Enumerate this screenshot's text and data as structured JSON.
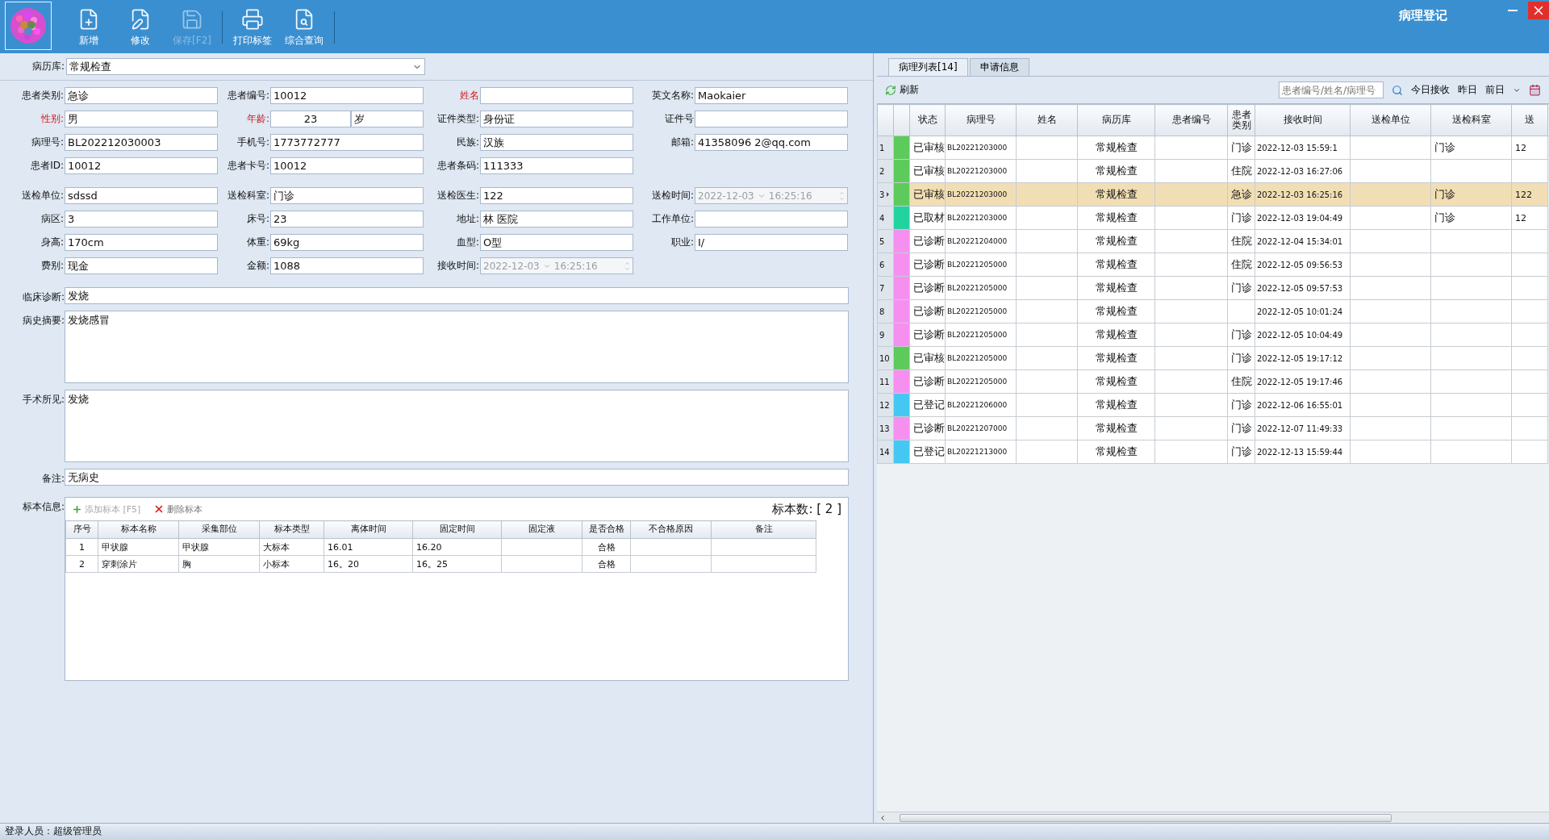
{
  "window": {
    "title": "病理登记"
  },
  "toolbar": [
    {
      "label": "新增",
      "kind": "new",
      "disabled": false
    },
    {
      "label": "修改",
      "kind": "edit",
      "disabled": false
    },
    {
      "label": "保存[F2]",
      "kind": "save",
      "disabled": true
    },
    {
      "label": "打印标签",
      "kind": "print",
      "disabled": false
    },
    {
      "label": "综合查询",
      "kind": "query",
      "disabled": false
    }
  ],
  "library": {
    "label": "病历库:",
    "value": "常规检查"
  },
  "groups": [
    {
      "rows": [
        [
          {
            "kind": "text",
            "label": "患者类别:",
            "value": "急诊",
            "required": false
          },
          {
            "kind": "text",
            "label": "患者编号:",
            "value": "10012",
            "required": false
          },
          {
            "kind": "text",
            "label": "姓名",
            "required": true
          },
          {
            "kind": "text",
            "label": "英文名称:",
            "value": "Maokaier",
            "required": false
          }
        ],
        [
          {
            "kind": "text",
            "label": "性别:",
            "value": "男",
            "required": true
          },
          {
            "kind": "age",
            "label": "年龄:",
            "value": "23",
            "unit": "岁",
            "required": true
          },
          {
            "kind": "text",
            "label": "证件类型:",
            "value": "身份证",
            "required": false
          },
          {
            "kind": "text",
            "label": "证件号",
            "required": false
          }
        ],
        [
          {
            "kind": "text",
            "label": "病理号:",
            "value": "BL202212030003",
            "required": false
          },
          {
            "kind": "text",
            "label": "手机号:",
            "value": "1773772777",
            "required": false
          },
          {
            "kind": "text",
            "label": "民族:",
            "value": "汉族",
            "required": false
          },
          {
            "kind": "text",
            "label": "邮箱:",
            "value": "41358096 2@qq.com",
            "required": false
          }
        ],
        [
          {
            "kind": "text",
            "label": "患者ID:",
            "value": "10012",
            "required": false
          },
          {
            "kind": "text",
            "label": "患者卡号:",
            "value": "10012",
            "required": false
          },
          {
            "kind": "text",
            "label": "患者条码:",
            "value": "111333",
            "required": false
          }
        ]
      ]
    },
    {
      "rows": [
        [
          {
            "kind": "text",
            "label": "送检单位:",
            "value": "sdssd",
            "required": false
          },
          {
            "kind": "text",
            "label": "送检科室:",
            "value": "门诊",
            "required": false
          },
          {
            "kind": "text",
            "label": "送检医生:",
            "value": "122",
            "required": false
          },
          {
            "kind": "datetime",
            "label": "送检时间:",
            "date": "2022-12-03",
            "time": "16:25:16",
            "required": false
          }
        ],
        [
          {
            "kind": "text",
            "label": "病区:",
            "value": "3",
            "required": false
          },
          {
            "kind": "text",
            "label": "床号:",
            "value": "23",
            "required": false
          },
          {
            "kind": "text",
            "label": "地址:",
            "value": "林        医院",
            "required": false
          },
          {
            "kind": "text",
            "label": "工作单位:",
            "required": false
          }
        ],
        [
          {
            "kind": "text",
            "label": "身高:",
            "value": "170cm",
            "required": false
          },
          {
            "kind": "text",
            "label": "体重:",
            "value": "69kg",
            "required": false
          },
          {
            "kind": "text",
            "label": "血型:",
            "value": "O型",
            "required": false
          },
          {
            "kind": "text",
            "label": "职业:",
            "value": "I/",
            "required": false
          }
        ],
        [
          {
            "kind": "text",
            "label": "费别:",
            "value": "现金",
            "required": false
          },
          {
            "kind": "text",
            "label": "金额:",
            "value": "1088",
            "required": false
          },
          {
            "kind": "datetime",
            "label": "接收时间:",
            "date": "2022-12-03",
            "time": "16:25:16",
            "required": false
          }
        ]
      ]
    }
  ],
  "wide_fields": [
    {
      "kind": "line",
      "label": "临床诊断:",
      "value": "发烧"
    },
    {
      "kind": "area",
      "label": "病史摘要:",
      "value": "发烧感冒"
    },
    {
      "kind": "area",
      "label": "手术所见:",
      "value": "发烧"
    },
    {
      "kind": "line",
      "label": "备注:",
      "value": "无病史"
    }
  ],
  "specimens": {
    "label": "标本信息:",
    "add": {
      "label": "添加标本 [F5]",
      "disabled": true
    },
    "remove": {
      "label": "删除标本",
      "disabled": false
    },
    "count_label": "标本数: [ 2 ]",
    "columns": [
      "序号",
      "标本名称",
      "采集部位",
      "标本类型",
      "离体时间",
      "固定时间",
      "固定液",
      "是否合格",
      "不合格原因",
      "备注"
    ],
    "rows": [
      [
        "1",
        "甲状腺",
        "甲状腺",
        "大标本",
        "16.01",
        "16.20",
        "",
        "合格",
        "",
        ""
      ],
      [
        "2",
        "穿刺涂片",
        "胸",
        "小标本",
        "16。20",
        "16。25",
        "",
        "合格",
        "",
        ""
      ]
    ]
  },
  "tabs": [
    {
      "label": "病理列表[14]",
      "selected": true
    },
    {
      "label": "申请信息",
      "selected": false
    }
  ],
  "list_toolbar": {
    "refresh": "刷新",
    "search_placeholder": "患者编号/姓名/病理号",
    "filters": [
      "今日接收",
      "昨日",
      "前日"
    ]
  },
  "table": {
    "columns": [
      "状态",
      "病理号",
      "姓名",
      "病历库",
      "患者编号",
      "患者类别",
      "接收时间",
      "送检单位",
      "送检科室",
      "送"
    ],
    "rows": [
      {
        "num": "1",
        "status": "已审核",
        "color": "#5ccb5c",
        "selected": false,
        "pathology_no": "BL20221203000",
        "library": "常规检查",
        "patient_type": "门诊",
        "received": "2022-12-03 15:59:1",
        "dept": "门诊",
        "column_10": "12"
      },
      {
        "num": "2",
        "status": "已审核",
        "color": "#5ccb5c",
        "selected": false,
        "pathology_no": "BL20221203000",
        "library": "常规检查",
        "patient_type": "住院",
        "received": "2022-12-03 16:27:06"
      },
      {
        "num": "3",
        "status": "已审核",
        "color": "#5ccb5c",
        "selected": true,
        "pathology_no": "BL20221203000",
        "library": "常规检查",
        "patient_type": "急诊",
        "received": "2022-12-03 16:25:16",
        "dept": "门诊",
        "column_10": "122"
      },
      {
        "num": "4",
        "status": "已取材",
        "color": "#22d3a0",
        "selected": false,
        "pathology_no": "BL20221203000",
        "library": "常规检查",
        "patient_type": "门诊",
        "received": "2022-12-03 19:04:49",
        "dept": "门诊",
        "column_10": "12"
      },
      {
        "num": "5",
        "status": "已诊断",
        "color": "#f590f0",
        "selected": false,
        "pathology_no": "BL20221204000",
        "library": "常规检查",
        "patient_type": "住院",
        "received": "2022-12-04 15:34:01"
      },
      {
        "num": "6",
        "status": "已诊断",
        "color": "#f590f0",
        "selected": false,
        "pathology_no": "BL20221205000",
        "library": "常规检查",
        "patient_type": "住院",
        "received": "2022-12-05 09:56:53"
      },
      {
        "num": "7",
        "status": "已诊断",
        "color": "#f590f0",
        "selected": false,
        "pathology_no": "BL20221205000",
        "library": "常规检查",
        "patient_type": "门诊",
        "received": "2022-12-05 09:57:53"
      },
      {
        "num": "8",
        "status": "已诊断",
        "color": "#f590f0",
        "selected": false,
        "pathology_no": "BL20221205000",
        "library": "常规检查",
        "received": "2022-12-05 10:01:24"
      },
      {
        "num": "9",
        "status": "已诊断",
        "color": "#f590f0",
        "selected": false,
        "pathology_no": "BL20221205000",
        "library": "常规检查",
        "patient_type": "门诊",
        "received": "2022-12-05 10:04:49"
      },
      {
        "num": "10",
        "status": "已审核",
        "color": "#5ccb5c",
        "selected": false,
        "pathology_no": "BL20221205000",
        "library": "常规检查",
        "patient_type": "门诊",
        "received": "2022-12-05 19:17:12"
      },
      {
        "num": "11",
        "status": "已诊断",
        "color": "#f590f0",
        "selected": false,
        "pathology_no": "BL20221205000",
        "library": "常规检查",
        "patient_type": "住院",
        "received": "2022-12-05 19:17:46"
      },
      {
        "num": "12",
        "status": "已登记",
        "color": "#44c8f2",
        "selected": false,
        "pathology_no": "BL20221206000",
        "library": "常规检查",
        "patient_type": "门诊",
        "received": "2022-12-06 16:55:01"
      },
      {
        "num": "13",
        "status": "已诊断",
        "color": "#f590f0",
        "selected": false,
        "pathology_no": "BL20221207000",
        "library": "常规检查",
        "patient_type": "门诊",
        "received": "2022-12-07 11:49:33"
      },
      {
        "num": "14",
        "status": "已登记",
        "color": "#44c8f2",
        "selected": false,
        "pathology_no": "BL20221213000",
        "library": "常规检查",
        "patient_type": "门诊",
        "received": "2022-12-13 15:59:44"
      }
    ]
  },
  "status_bar": {
    "user": "登录人员：超级管理员"
  }
}
